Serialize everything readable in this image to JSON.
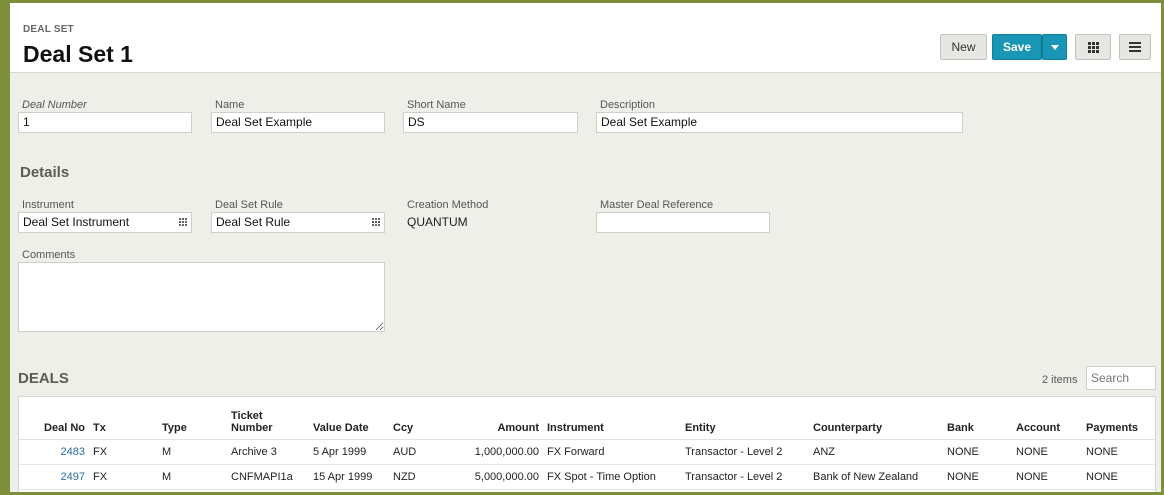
{
  "header": {
    "eyebrow": "DEAL SET",
    "title": "Deal Set 1",
    "buttons": {
      "new": "New",
      "save": "Save"
    }
  },
  "form": {
    "deal_number": {
      "label": "Deal Number",
      "value": "1"
    },
    "name": {
      "label": "Name",
      "value": "Deal Set Example"
    },
    "short_name": {
      "label": "Short Name",
      "value": "DS"
    },
    "description": {
      "label": "Description",
      "value": "Deal Set Example"
    }
  },
  "details": {
    "title": "Details",
    "instrument": {
      "label": "Instrument",
      "value": "Deal Set Instrument"
    },
    "deal_set_rule": {
      "label": "Deal Set Rule",
      "value": "Deal Set Rule"
    },
    "creation_method": {
      "label": "Creation Method",
      "value": "QUANTUM"
    },
    "master_deal_reference": {
      "label": "Master Deal Reference",
      "value": ""
    },
    "comments": {
      "label": "Comments",
      "value": ""
    }
  },
  "deals": {
    "title": "DEALS",
    "items_count": "2 items",
    "search_placeholder": "Search",
    "columns": [
      "Deal No",
      "Tx",
      "Type",
      "Ticket Number",
      "Value Date",
      "Ccy",
      "Amount",
      "Instrument",
      "Entity",
      "Counterparty",
      "Bank",
      "Account",
      "Payments"
    ],
    "rows": [
      [
        "2483",
        "FX",
        "M",
        "Archive 3",
        "5 Apr 1999",
        "AUD",
        "1,000,000.00",
        "FX Forward",
        "Transactor - Level 2",
        "ANZ",
        "NONE",
        "NONE",
        "NONE"
      ],
      [
        "2497",
        "FX",
        "M",
        "CNFMAPI1a",
        "15 Apr 1999",
        "NZD",
        "5,000,000.00",
        "FX Spot - Time Option",
        "Transactor - Level 2",
        "Bank of New Zealand",
        "NONE",
        "NONE",
        "NONE"
      ]
    ]
  },
  "colors": {
    "frame": "#7d8f3a",
    "save_button": "#1996b5",
    "link": "#2a6ea5",
    "background": "#efefea"
  }
}
